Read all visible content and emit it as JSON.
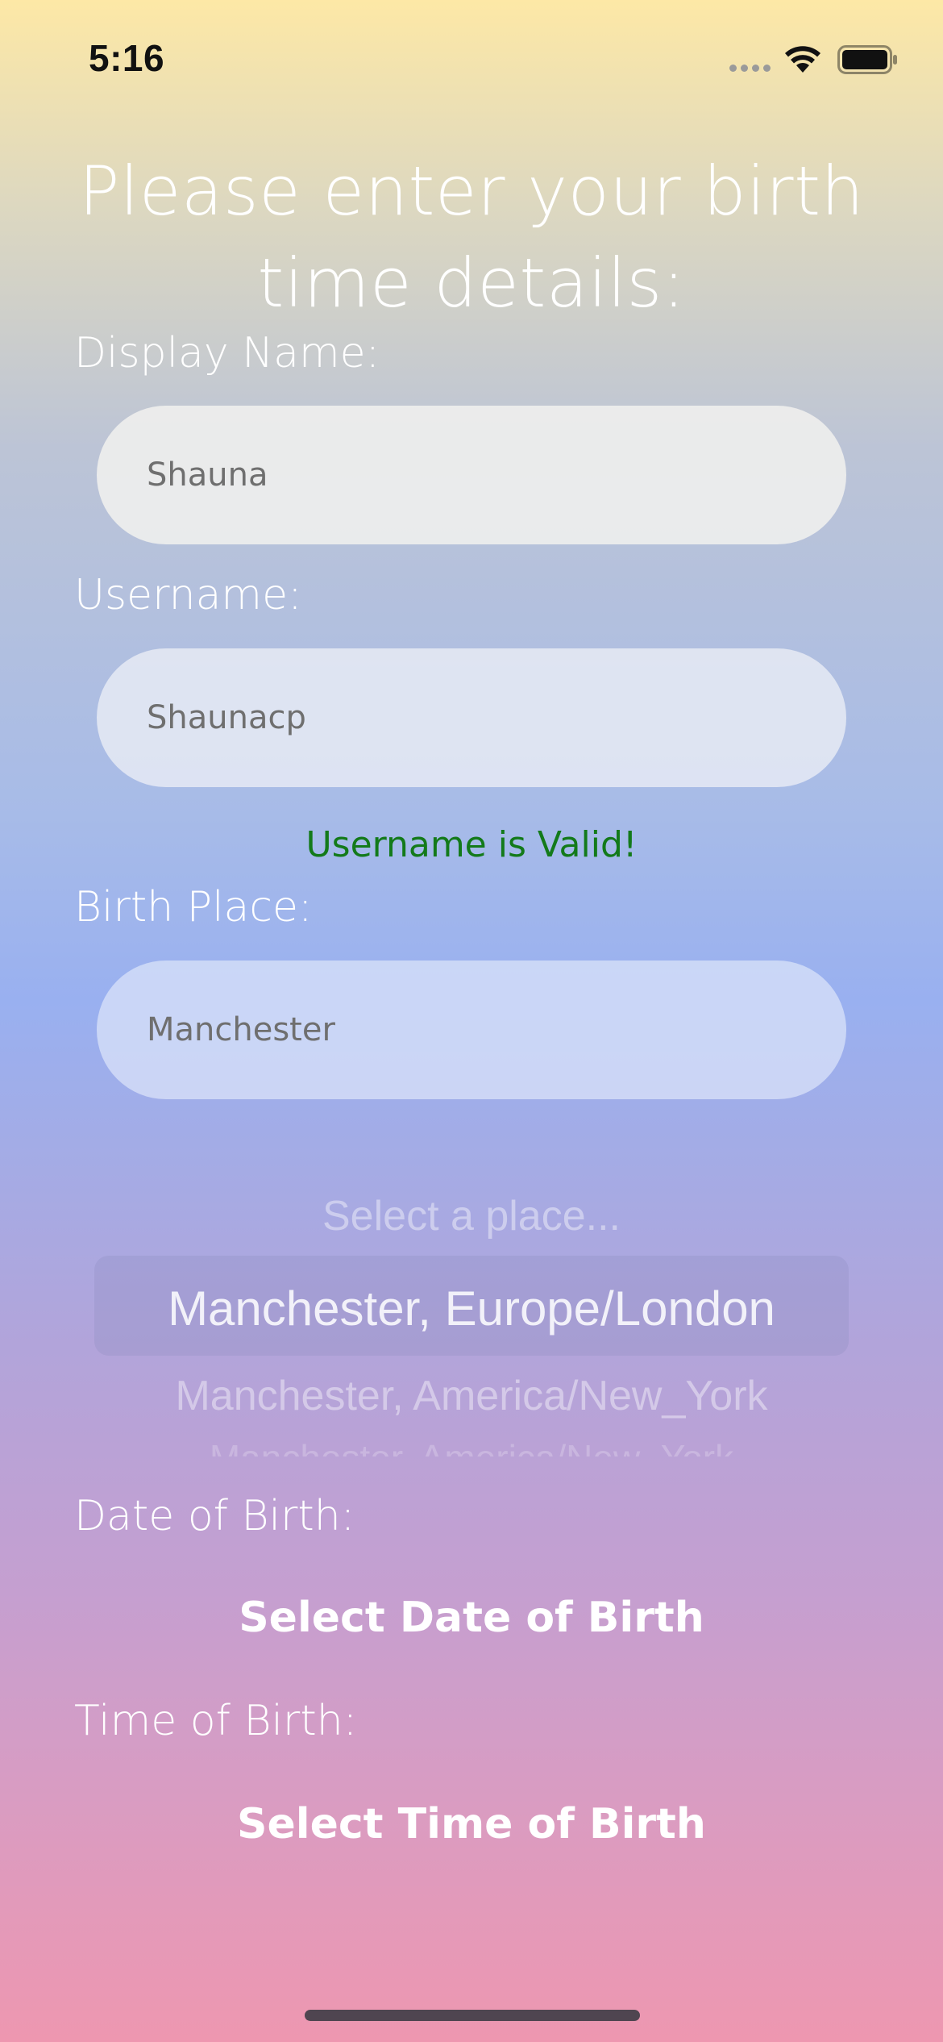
{
  "status_bar": {
    "time": "5:16"
  },
  "form": {
    "title": "Please enter your birth time details:",
    "display_name": {
      "label": "Display Name:",
      "value": "Shauna"
    },
    "username": {
      "label": "Username:",
      "value": "Shaunacp",
      "validation": "Username is Valid!"
    },
    "birth_place": {
      "label": "Birth Place:",
      "value": "Manchester"
    },
    "place_picker": {
      "options": [
        "Select a place...",
        "Manchester, Europe/London",
        "Manchester, America/New_York",
        "Manchester, America/New_York"
      ],
      "selected": "Manchester, Europe/London"
    },
    "date_of_birth": {
      "label": "Date of Birth:",
      "button": "Select Date of Birth"
    },
    "time_of_birth": {
      "label": "Time of Birth:",
      "button": "Select Time of Birth"
    }
  },
  "colors": {
    "valid_text": "#137a1a",
    "gradient_top": "#fde8a6",
    "gradient_mid": "#99b0f0",
    "gradient_bottom": "#ee97b0"
  },
  "icons": [
    "signal-dots-icon",
    "wifi-icon",
    "battery-icon"
  ]
}
